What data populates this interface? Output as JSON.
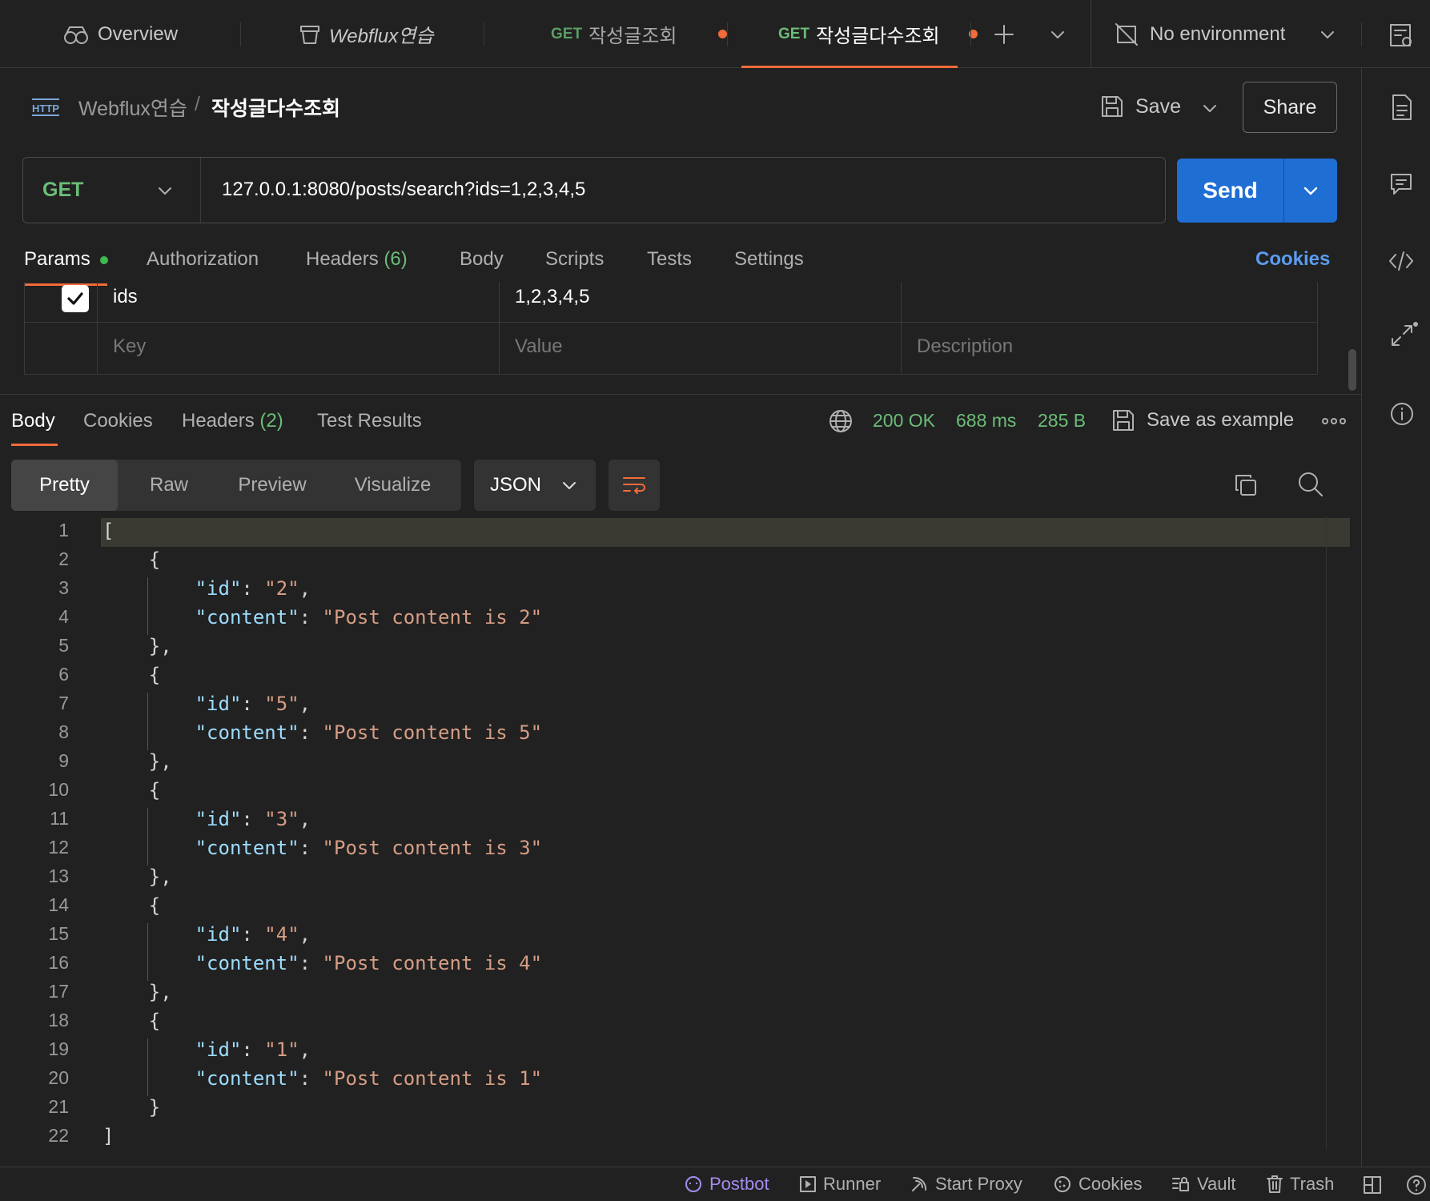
{
  "tabs": {
    "overview": "Overview",
    "collection": "Webflux연습",
    "tab1": {
      "method": "GET",
      "name": "작성글조회"
    },
    "tab2": {
      "method": "GET",
      "name": "작성글다수조회"
    },
    "environment": "No environment"
  },
  "breadcrumb": {
    "collection": "Webflux연습",
    "separator": "/",
    "request": "작성글다수조회"
  },
  "header": {
    "save": "Save",
    "share": "Share"
  },
  "request": {
    "method": "GET",
    "url": "127.0.0.1:8080/posts/search?ids=1,2,3,4,5",
    "send": "Send"
  },
  "request_tabs": {
    "params": "Params",
    "authorization": "Authorization",
    "headers": "Headers",
    "headers_count": "(6)",
    "body": "Body",
    "scripts": "Scripts",
    "tests": "Tests",
    "settings": "Settings",
    "cookies": "Cookies"
  },
  "params": {
    "rows": [
      {
        "key": "ids",
        "value": "1,2,3,4,5",
        "checked": true
      }
    ],
    "placeholders": {
      "key": "Key",
      "value": "Value",
      "description": "Description"
    }
  },
  "response_tabs": {
    "body": "Body",
    "cookies": "Cookies",
    "headers": "Headers",
    "headers_count": "(2)",
    "test_results": "Test Results"
  },
  "response_status": {
    "status": "200 OK",
    "time": "688 ms",
    "size": "285 B",
    "save_example": "Save as example"
  },
  "view_modes": {
    "pretty": "Pretty",
    "raw": "Raw",
    "preview": "Preview",
    "visualize": "Visualize",
    "format": "JSON"
  },
  "response_body": [
    {
      "id": "2",
      "content": "Post content is 2"
    },
    {
      "id": "5",
      "content": "Post content is 5"
    },
    {
      "id": "3",
      "content": "Post content is 3"
    },
    {
      "id": "4",
      "content": "Post content is 4"
    },
    {
      "id": "1",
      "content": "Post content is 1"
    }
  ],
  "footer": {
    "postbot": "Postbot",
    "runner": "Runner",
    "start_proxy": "Start Proxy",
    "cookies": "Cookies",
    "vault": "Vault",
    "trash": "Trash"
  },
  "colors": {
    "accent": "#f26b3a",
    "send": "#1f6ed4",
    "method_green": "#6bbd78",
    "cookies_link": "#5b9cf0"
  }
}
